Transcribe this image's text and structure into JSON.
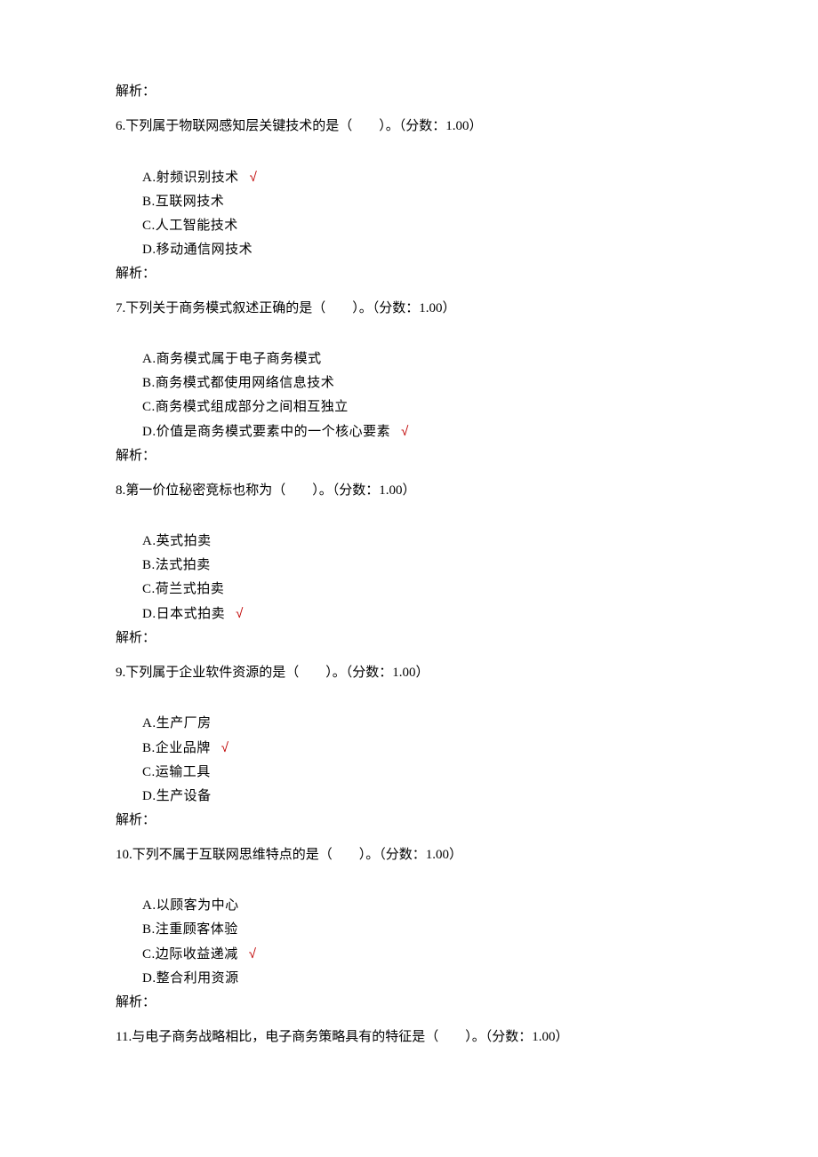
{
  "labels": {
    "analysis": "解析：",
    "score_prefix": "（分数：",
    "score_suffix": "）",
    "blank": "（　　）。",
    "check": "√"
  },
  "top_analysis": "解析：",
  "questions": [
    {
      "num": "6.",
      "stem": "下列属于物联网感知层关键技术的是（　　）。",
      "score": "1.00",
      "options": [
        {
          "letter": "A.",
          "text": "射频识别技术",
          "correct": true
        },
        {
          "letter": "B.",
          "text": "互联网技术",
          "correct": false
        },
        {
          "letter": "C.",
          "text": "人工智能技术",
          "correct": false
        },
        {
          "letter": "D.",
          "text": "移动通信网技术",
          "correct": false
        }
      ]
    },
    {
      "num": "7.",
      "stem": "下列关于商务模式叙述正确的是（　　）。",
      "score": "1.00",
      "options": [
        {
          "letter": "A.",
          "text": "商务模式属于电子商务模式",
          "correct": false
        },
        {
          "letter": "B.",
          "text": "商务模式都使用网络信息技术",
          "correct": false
        },
        {
          "letter": "C.",
          "text": "商务模式组成部分之间相互独立",
          "correct": false
        },
        {
          "letter": "D.",
          "text": "价值是商务模式要素中的一个核心要素",
          "correct": true
        }
      ]
    },
    {
      "num": "8.",
      "stem": "第一价位秘密竞标也称为（　　）。",
      "score": "1.00",
      "options": [
        {
          "letter": "A.",
          "text": "英式拍卖",
          "correct": false
        },
        {
          "letter": "B.",
          "text": "法式拍卖",
          "correct": false
        },
        {
          "letter": "C.",
          "text": "荷兰式拍卖",
          "correct": false
        },
        {
          "letter": "D.",
          "text": "日本式拍卖",
          "correct": true
        }
      ]
    },
    {
      "num": "9.",
      "stem": "下列属于企业软件资源的是（　　）。",
      "score": "1.00",
      "options": [
        {
          "letter": "A.",
          "text": "生产厂房",
          "correct": false
        },
        {
          "letter": "B.",
          "text": "企业品牌",
          "correct": true
        },
        {
          "letter": "C.",
          "text": "运输工具",
          "correct": false
        },
        {
          "letter": "D.",
          "text": "生产设备",
          "correct": false
        }
      ]
    },
    {
      "num": "10.",
      "stem": "下列不属于互联网思维特点的是（　　）。",
      "score": "1.00",
      "options": [
        {
          "letter": "A.",
          "text": "以顾客为中心",
          "correct": false
        },
        {
          "letter": "B.",
          "text": "注重顾客体验",
          "correct": false
        },
        {
          "letter": "C.",
          "text": "边际收益递减",
          "correct": true
        },
        {
          "letter": "D.",
          "text": "整合利用资源",
          "correct": false
        }
      ]
    },
    {
      "num": "11.",
      "stem": "与电子商务战略相比，电子商务策略具有的特征是（　　）。",
      "score": "1.00",
      "options": []
    }
  ]
}
